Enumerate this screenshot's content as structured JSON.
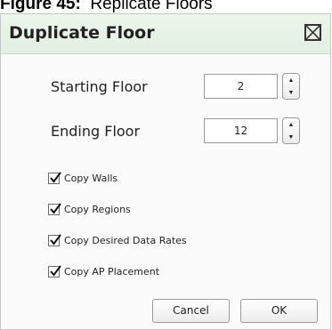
{
  "caption": {
    "figure_label": "Figure 45:",
    "text": "Replicate Floors"
  },
  "dialog": {
    "title": "Duplicate Floor",
    "close_icon": "close-box-icon",
    "starting_floor": {
      "label": "Starting Floor",
      "value": "2"
    },
    "ending_floor": {
      "label": "Ending Floor",
      "value": "12"
    },
    "spinner_up_glyph": "▲",
    "spinner_down_glyph": "▼",
    "options": [
      {
        "label": "Copy Walls",
        "checked": true
      },
      {
        "label": "Copy Regions",
        "checked": true
      },
      {
        "label": "Copy Desired Data Rates",
        "checked": true
      },
      {
        "label": "Copy AP Placement",
        "checked": true
      }
    ],
    "buttons": {
      "cancel": "Cancel",
      "ok": "OK"
    }
  }
}
